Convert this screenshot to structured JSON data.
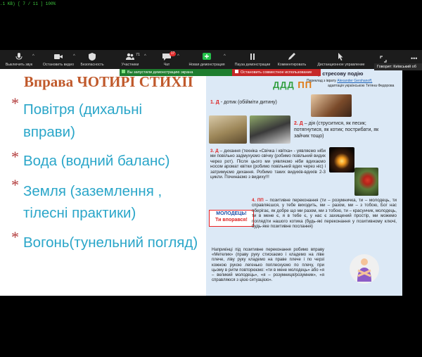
{
  "status_bar": {
    "text": ".1 KB) [ 7 / 11 ]  100%"
  },
  "toolbar": {
    "items": [
      {
        "label": "Выключить звук",
        "icon": "microphone-icon"
      },
      {
        "label": "Остановить видео",
        "icon": "video-camera-icon"
      },
      {
        "label": "Безопасность",
        "icon": "shield-icon"
      },
      {
        "label": "Участники",
        "icon": "participants-icon",
        "count": "71"
      },
      {
        "label": "Чат",
        "icon": "chat-icon",
        "badge": "17"
      },
      {
        "label": "Новая демонстрация",
        "icon": "share-screen-icon"
      },
      {
        "label": "Пауза демонстрации",
        "icon": "pause-icon"
      },
      {
        "label": "Комментировать",
        "icon": "pen-icon"
      },
      {
        "label": "Дистанционное управление",
        "icon": "remote-control-icon"
      }
    ],
    "speaking": "Говорит: Київський об"
  },
  "banners": {
    "sharing": "Вы запустили демонстрацию экрана",
    "stop": "Остановить совместное использование"
  },
  "slide": {
    "title_prefix": "Вправа ",
    "title_main": "ЧОТИРІ СТИХІЇ",
    "items": [
      "Повітря (дихальні",
      "вправи)",
      "Вода (водний баланс)",
      "Земля (заземлення ,",
      "тілесні практики)",
      "Вогонь(тунельний погляд)"
    ],
    "bullet": "*"
  },
  "document": {
    "header_title": "у стресову подію",
    "credit_line1": "Переклад з іврату",
    "credit_author": "Alexander Gershanoff,",
    "credit_line2": "адаптація українською Тетяна Федорова",
    "ddd": "ДДД",
    "pp": "ПП",
    "p1_lead": "1. Д",
    "p1": " - дотик (обійміти дитину)",
    "p2_lead": "2. Д",
    "p2": " – дія (струситися, як песик; потягнутися, як котик; пострибати, як зайчик тощо)",
    "p3_lead": "3. Д",
    "p3": " – дихання (техніка «Свічка і квітка» - уявляємо ніби ми повільно задмухуємо свічку (робимо повільний видих через рот). Після цього ми уявляємо ніби вдихаємо носом аромат квітки (робимо повільний вдих через ніс) і затримуємо дихання. Робимо таких видихів-вдихів 2-3 цикли. Починаємо з видиху!!!",
    "stamp_line1": "МОЛОДЕЦЬ!",
    "stamp_line2": "Ти впорався!",
    "p4_lead": "4. ПП",
    "p4": " – позитивне переконання (ти – розумничка, ти – молодець, ти справляєшся, у тебе виходить, ми – разом, ми – з тобою, Бог нас оберігає, як добре що ми разом, ми з тобою, ти – красунчик, молодець, ти в мене є, я в тебе є, у нас є захищений простір, ми можемо поглядіти нашого котика (будь-які переконання у позитивному ключі, будь-яке позитивне послання)",
    "p5": "Наприкінці під позитивне переконання робимо вправу «Метелик» (праву руку стискаємо і кладемо на ліве плече, ліву руку кладемо на праве плече і по черзі кожною рукою легенько поплескуємо по плечу, при цьому в ритм повторюємо: «ти в мене молодець» або «я – великий молодець», «я – розумниця/розумник», «я справляюся з цією ситуацією»."
  },
  "colors": {
    "title": "#c0592b",
    "items": "#2aa6c9",
    "bullets": "#b23a3a",
    "doc_bg": "#dce9f6",
    "banner_green": "#1e7d2e",
    "banner_red": "#c62828"
  }
}
